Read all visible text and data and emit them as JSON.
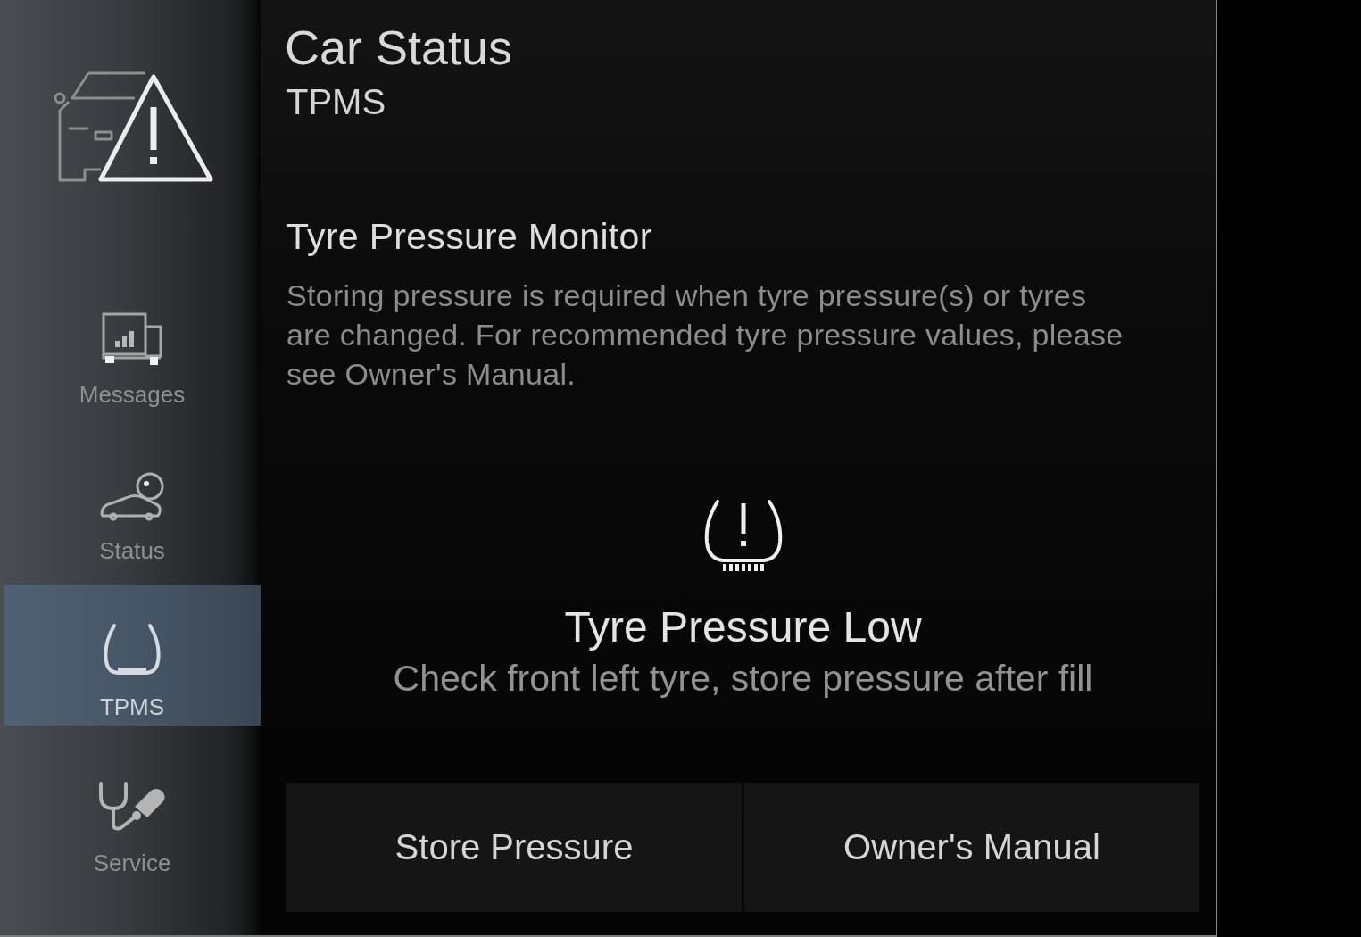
{
  "header": {
    "title": "Car Status",
    "subtitle": "TPMS"
  },
  "sidebar": {
    "items": [
      {
        "label": "Messages",
        "selected": false
      },
      {
        "label": "Status",
        "selected": false
      },
      {
        "label": "TPMS",
        "selected": true
      },
      {
        "label": "Service",
        "selected": false
      }
    ]
  },
  "section": {
    "title": "Tyre Pressure Monitor",
    "description": "Storing pressure is required when tyre pressure(s) or tyres are changed. For recommended tyre pressure values, please see Owner's Manual."
  },
  "alert": {
    "title": "Tyre Pressure Low",
    "message": "Check front left tyre, store pressure after fill"
  },
  "buttons": [
    {
      "label": "Store Pressure"
    },
    {
      "label": "Owner's Manual"
    }
  ]
}
